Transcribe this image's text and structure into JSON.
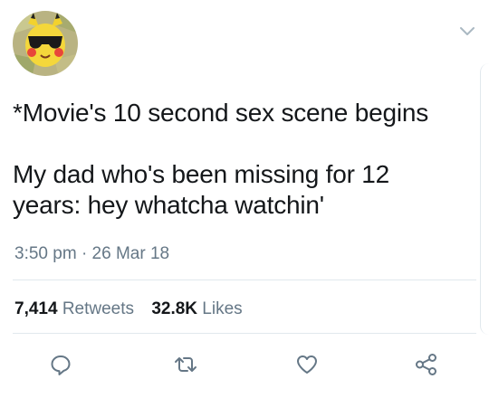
{
  "tweet": {
    "text": "*Movie's 10 second sex scene begins\n\nMy dad who's been missing for 12\nyears: hey whatcha watchin'",
    "time": "3:50 pm",
    "separator": "·",
    "date": "26 Mar 18"
  },
  "stats": {
    "retweets_count": "7,414",
    "retweets_label": "Retweets",
    "likes_count": "32.8K",
    "likes_label": "Likes"
  },
  "icons": {
    "avatar": "pikachu-sunglasses-money-avatar",
    "menu": "chevron-down-icon",
    "reply": "reply-icon",
    "retweet": "retweet-icon",
    "like": "heart-icon",
    "share": "share-icon"
  },
  "colors": {
    "text": "#14171a",
    "secondary": "#657786",
    "divider": "#e1e8ed",
    "icon": "#657786"
  }
}
